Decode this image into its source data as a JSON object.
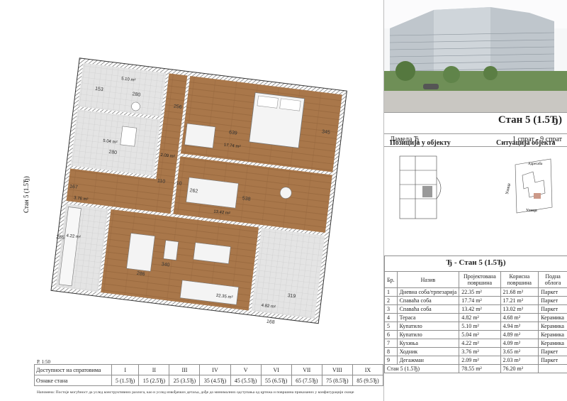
{
  "apartment_title": "Стан 5 (1.5Ђ)",
  "lamela": "Ламела Ђ",
  "floors": "1 спрат - 9 спрат",
  "position_title": "Позиција у објекту",
  "situation_title": "Ситуација објекта",
  "situation_labels": {
    "street_top": "Улица",
    "street_bottom": "Улица",
    "block": "Адресаба"
  },
  "plan_side_label": "Стан 5 (1.5Ђ)",
  "plan": {
    "rooms": [
      {
        "area": "5.10 m²"
      },
      {
        "area": "5.04 m²"
      },
      {
        "area": "2.09 m²"
      },
      {
        "area": "17.74 m²"
      },
      {
        "area": "13.42 m²"
      },
      {
        "area": "3.76 m²"
      },
      {
        "area": "4.22 m²"
      },
      {
        "area": "22.35 m²"
      },
      {
        "area": "4.82 m²"
      }
    ],
    "dims": [
      "153",
      "280",
      "280",
      "256",
      "639",
      "345",
      "110",
      "10",
      "262",
      "538",
      "167",
      "255",
      "286",
      "340",
      "319",
      "168"
    ]
  },
  "table": {
    "caption": "Ђ - Стан 5 (1.5Ђ)",
    "headers": [
      "Бр.",
      "Назив",
      "Пројектована површина",
      "Корисна површина",
      "Подна облога"
    ],
    "rows": [
      [
        "1",
        "Дневна соба/трпезарија",
        "22.35 m²",
        "21.68 m²",
        "Паркет"
      ],
      [
        "2",
        "Спаваћа соба",
        "17.74 m²",
        "17.21 m²",
        "Паркет"
      ],
      [
        "3",
        "Спаваћа соба",
        "13.42 m²",
        "13.02 m²",
        "Паркет"
      ],
      [
        "4",
        "Тераса",
        "4.82 m²",
        "4.68 m²",
        "Керамика"
      ],
      [
        "5",
        "Купатило",
        "5.10 m²",
        "4.94 m²",
        "Керамика"
      ],
      [
        "6",
        "Купатило",
        "5.04 m²",
        "4.89 m²",
        "Керамика"
      ],
      [
        "7",
        "Кухиња",
        "4.22 m²",
        "4.09 m²",
        "Керамика"
      ],
      [
        "8",
        "Ходник",
        "3.76 m²",
        "3.65 m²",
        "Паркет"
      ],
      [
        "9",
        "Дегажман",
        "2.09 m²",
        "2.03 m²",
        "Паркет"
      ]
    ],
    "total": [
      "Стан 5 (1.5Ђ)",
      "78.55 m²",
      "76.20 m²"
    ]
  },
  "scale": "Р. 1:50",
  "floor_table": {
    "row1_label": "Доступност на спратовима",
    "row2_label": "Ознаке стана",
    "floors": [
      "I",
      "II",
      "III",
      "IV",
      "V",
      "VI",
      "VII",
      "VIII",
      "IX"
    ],
    "marks": [
      "5 (1.5Ђ)",
      "15 (2.5Ђ)",
      "25 (3.5Ђ)",
      "35 (4.5Ђ)",
      "45 (5.5Ђ)",
      "55 (6.5Ђ)",
      "65 (7.5Ђ)",
      "75 (8.5Ђ)",
      "85 (9.5Ђ)"
    ]
  },
  "note": "Напомена: Постоје могућност да услед конструктивних разлога, као и услед извођачких детаља, дође до минималних одступања од цртежа и површина приказаних у конфигурацији скице",
  "colors": {
    "wood": "#a9774a",
    "tile": "#dcdcdc",
    "wall": "#3a3a3a"
  }
}
